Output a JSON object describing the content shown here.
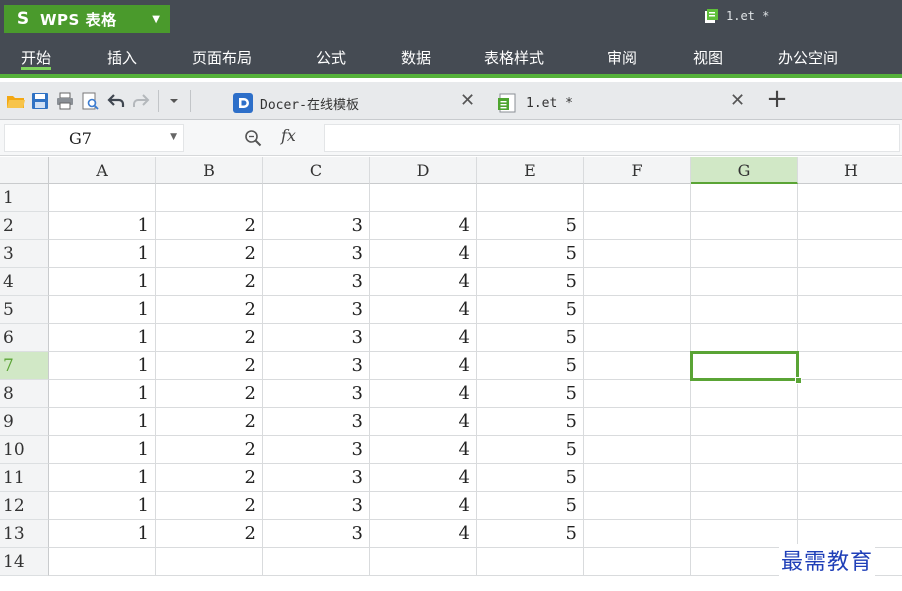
{
  "app": {
    "name": "WPS 表格",
    "logo": "S"
  },
  "window": {
    "doc_title": "1.et *"
  },
  "menu": [
    {
      "label": "开始",
      "active": true
    },
    {
      "label": "插入"
    },
    {
      "label": "页面布局"
    },
    {
      "label": "公式"
    },
    {
      "label": "数据"
    },
    {
      "label": "表格样式"
    },
    {
      "label": "审阅"
    },
    {
      "label": "视图"
    },
    {
      "label": "办公空间"
    }
  ],
  "quick_access_icons": [
    "open-folder-icon",
    "save-icon",
    "print-icon",
    "print-preview-icon",
    "undo-icon",
    "redo-icon",
    "more-dropdown-icon"
  ],
  "tabs": [
    {
      "label": "Docer-在线模板",
      "icon": "docer-icon"
    },
    {
      "label": "1.et *",
      "icon": "spreadsheet-icon",
      "active": true
    }
  ],
  "formula_bar": {
    "cell_ref": "G7",
    "fx": "fx",
    "value": ""
  },
  "sheet": {
    "columns": [
      "A",
      "B",
      "C",
      "D",
      "E",
      "F",
      "G",
      "H"
    ],
    "selected_column": "G",
    "selected_row": "7",
    "rows": [
      {
        "label": "1",
        "cells": [
          "",
          "",
          "",
          "",
          "",
          "",
          "",
          ""
        ]
      },
      {
        "label": "2",
        "cells": [
          "1",
          "2",
          "3",
          "4",
          "5",
          "",
          "",
          ""
        ]
      },
      {
        "label": "3",
        "cells": [
          "1",
          "2",
          "3",
          "4",
          "5",
          "",
          "",
          ""
        ]
      },
      {
        "label": "4",
        "cells": [
          "1",
          "2",
          "3",
          "4",
          "5",
          "",
          "",
          ""
        ]
      },
      {
        "label": "5",
        "cells": [
          "1",
          "2",
          "3",
          "4",
          "5",
          "",
          "",
          ""
        ]
      },
      {
        "label": "6",
        "cells": [
          "1",
          "2",
          "3",
          "4",
          "5",
          "",
          "",
          ""
        ]
      },
      {
        "label": "7",
        "cells": [
          "1",
          "2",
          "3",
          "4",
          "5",
          "",
          "",
          ""
        ]
      },
      {
        "label": "8",
        "cells": [
          "1",
          "2",
          "3",
          "4",
          "5",
          "",
          "",
          ""
        ]
      },
      {
        "label": "9",
        "cells": [
          "1",
          "2",
          "3",
          "4",
          "5",
          "",
          "",
          ""
        ]
      },
      {
        "label": "10",
        "cells": [
          "1",
          "2",
          "3",
          "4",
          "5",
          "",
          "",
          ""
        ]
      },
      {
        "label": "11",
        "cells": [
          "1",
          "2",
          "3",
          "4",
          "5",
          "",
          "",
          ""
        ]
      },
      {
        "label": "12",
        "cells": [
          "1",
          "2",
          "3",
          "4",
          "5",
          "",
          "",
          ""
        ]
      },
      {
        "label": "13",
        "cells": [
          "1",
          "2",
          "3",
          "4",
          "5",
          "",
          "",
          ""
        ]
      },
      {
        "label": "14",
        "cells": [
          "",
          "",
          "",
          "",
          "",
          "",
          "",
          ""
        ]
      }
    ]
  },
  "watermark": "最需教育",
  "colors": {
    "titlebar": "#454b53",
    "accent": "#4a9a2c",
    "selection": "#5aa435",
    "watermark": "#1f3fb8"
  }
}
